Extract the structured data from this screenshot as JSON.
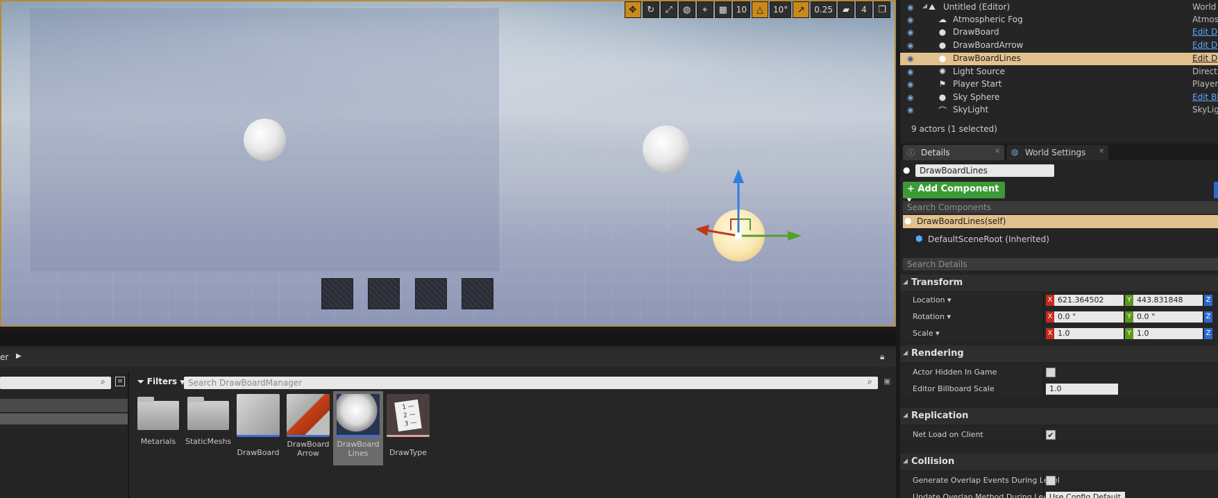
{
  "viewport": {
    "toolbar": {
      "grid_snap": "10",
      "rotation_snap": "10°",
      "scale_snap": "0.25",
      "camera_speed": "4"
    }
  },
  "outliner": {
    "rows": [
      {
        "label": "Untitled (Editor)",
        "type": "World",
        "link": false,
        "icon": "world-icon"
      },
      {
        "label": "Atmospheric Fog",
        "type": "Atmos",
        "link": false,
        "icon": "fog-icon"
      },
      {
        "label": "DrawBoard",
        "type": "Edit D",
        "link": true,
        "icon": "sphere-actor-icon"
      },
      {
        "label": "DrawBoardArrow",
        "type": "Edit D",
        "link": true,
        "icon": "sphere-actor-icon"
      },
      {
        "label": "DrawBoardLines",
        "type": "Edit D",
        "link": true,
        "icon": "sphere-actor-icon",
        "selected": true
      },
      {
        "label": "Light Source",
        "type": "Directi",
        "link": false,
        "icon": "light-icon"
      },
      {
        "label": "Player Start",
        "type": "Player",
        "link": false,
        "icon": "player-start-icon"
      },
      {
        "label": "Sky Sphere",
        "type": "Edit Bl",
        "link": true,
        "icon": "sphere-actor-icon"
      },
      {
        "label": "SkyLight",
        "type": "SkyLig",
        "link": false,
        "icon": "skylight-icon"
      }
    ],
    "status": "9 actors (1 selected)"
  },
  "details": {
    "tabs": [
      {
        "label": "Details"
      },
      {
        "label": "World Settings"
      }
    ],
    "name_field": "DrawBoardLines",
    "add_component_label": "+ Add Component",
    "search_components_placeholder": "Search Components",
    "components": {
      "self": "DrawBoardLines(self)",
      "root": "DefaultSceneRoot (Inherited)"
    },
    "search_details_placeholder": "Search Details",
    "transform": {
      "header": "Transform",
      "location_label": "Location",
      "rotation_label": "Rotation",
      "scale_label": "Scale",
      "location": {
        "x": "621.364502",
        "y": "443.831848"
      },
      "rotation": {
        "x": "0.0 °",
        "y": "0.0 °"
      },
      "scale": {
        "x": "1.0",
        "y": "1.0"
      }
    },
    "rendering": {
      "header": "Rendering",
      "hidden_label": "Actor Hidden In Game",
      "billboard_label": "Editor Billboard Scale",
      "billboard_value": "1.0"
    },
    "replication": {
      "header": "Replication",
      "net_load_label": "Net Load on Client"
    },
    "collision": {
      "header": "Collision",
      "overlap_label": "Generate Overlap Events During Level",
      "update_label": "Update Overlap Method During Level",
      "update_value": "Use Config Default"
    }
  },
  "content_browser": {
    "tab_label_fragment": "er",
    "filters_label": "Filters",
    "search_placeholder": "Search DrawBoardManager",
    "assets": [
      {
        "label": "Metarials",
        "kind": "folder"
      },
      {
        "label": "StaticMeshs",
        "kind": "folder"
      },
      {
        "label": "DrawBoard",
        "kind": "blueprint"
      },
      {
        "label": "DrawBoard Arrow",
        "kind": "blueprint"
      },
      {
        "label": "DrawBoard Lines",
        "kind": "blueprint",
        "selected": true
      },
      {
        "label": "DrawType",
        "kind": "enum"
      }
    ]
  }
}
